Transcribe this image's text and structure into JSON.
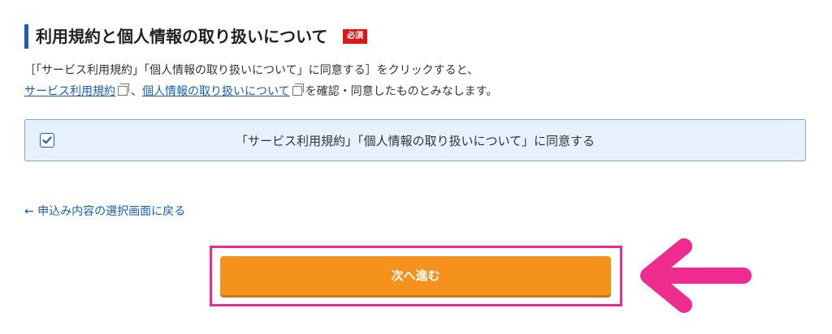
{
  "section": {
    "title": "利用規約と個人情報の取り扱いについて",
    "required_badge": "必須"
  },
  "description": {
    "line1": "［「サービス利用規約」「個人情報の取り扱いについて」に同意する］をクリックすると、",
    "link_terms": "サービス利用規約",
    "separator": "、",
    "link_privacy": "個人情報の取り扱いについて",
    "line2_suffix": "を確認・同意したものとみなします。"
  },
  "agreement": {
    "checked": true,
    "label": "「サービス利用規約」「個人情報の取り扱いについて」に同意する"
  },
  "back_link": "← 申込み内容の選択画面に戻る",
  "next_button": "次へ進む",
  "colors": {
    "accent_blue": "#1f5fb0",
    "button_orange": "#f5921e",
    "highlight_pink": "#ee2b8f",
    "required_red": "#d7191c"
  }
}
